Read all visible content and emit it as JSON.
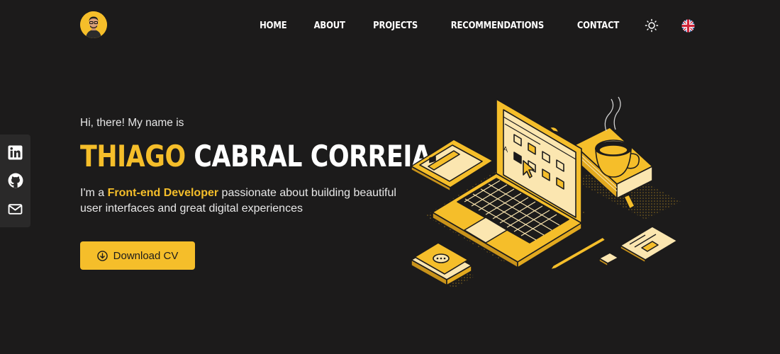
{
  "header": {
    "avatar_alt": "Profile photo",
    "nav": [
      {
        "label": "HOME"
      },
      {
        "label": "ABOUT"
      },
      {
        "label": "PROJECTS"
      },
      {
        "label": "RECOMMENDATIONS"
      },
      {
        "label": "CONTACT"
      }
    ],
    "theme_icon": "sun-icon",
    "language_icon": "uk-flag-icon"
  },
  "social": [
    {
      "icon": "linkedin-icon"
    },
    {
      "icon": "github-icon"
    },
    {
      "icon": "mail-icon"
    }
  ],
  "hero": {
    "greeting": "Hi, there! My name is",
    "name_first": "THIAGO",
    "name_last": "CABRAL CORREIA",
    "tagline_pre": "I'm a ",
    "tagline_highlight": "Front-end Developer",
    "tagline_post": " passionate about building beautiful user interfaces and great digital experiences",
    "cv_button": "Download CV",
    "cv_icon": "download-circle-icon"
  },
  "colors": {
    "background": "#1c1b1b",
    "accent": "#f5be2a",
    "sidebar": "#2a2929"
  }
}
